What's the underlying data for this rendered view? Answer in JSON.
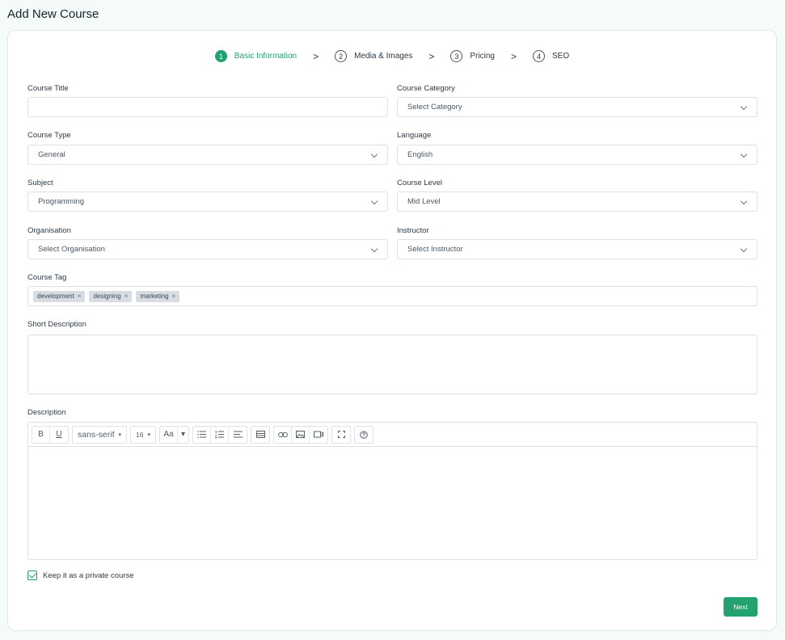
{
  "page_title": "Add New Course",
  "accent_color": "#23a16f",
  "stepper": {
    "steps": [
      {
        "num": "1",
        "label": "Basic Information",
        "active": true
      },
      {
        "num": "2",
        "label": "Media & Images",
        "active": false
      },
      {
        "num": "3",
        "label": "Pricing",
        "active": false
      },
      {
        "num": "4",
        "label": "SEO",
        "active": false
      }
    ],
    "separator": ">"
  },
  "form": {
    "course_title": {
      "label": "Course Title",
      "value": ""
    },
    "course_category": {
      "label": "Course Category",
      "value": "Select Category"
    },
    "course_type": {
      "label": "Course Type",
      "value": "General"
    },
    "language": {
      "label": "Language",
      "value": "English"
    },
    "subject": {
      "label": "Subject",
      "value": "Programming"
    },
    "course_level": {
      "label": "Course Level",
      "value": "Mid Level"
    },
    "organisation": {
      "label": "Organisation",
      "value": "Select Organisation"
    },
    "instructor": {
      "label": "Instructor",
      "value": "Select Instructor"
    },
    "course_tag": {
      "label": "Course Tag",
      "tags": [
        "development",
        "designing",
        "marketing"
      ],
      "remove_symbol": "×"
    },
    "short_description": {
      "label": "Short Description",
      "value": ""
    },
    "description": {
      "label": "Description",
      "toolbar": {
        "bold": "B",
        "underline": "U",
        "font_family": "sans-serif",
        "font_size": "16",
        "text_style": "Aa",
        "caret": "▾"
      }
    },
    "private_course": {
      "label": "Keep it as a private course",
      "checked": true
    }
  },
  "next_button": "Next"
}
